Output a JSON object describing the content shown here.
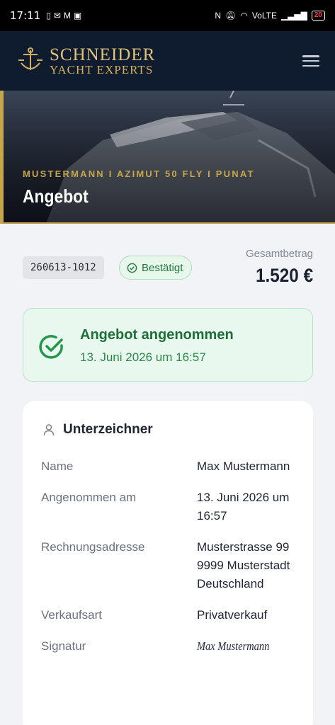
{
  "status_bar": {
    "time": "17:11",
    "network": "VoLTE",
    "battery": "20"
  },
  "header": {
    "brand_line1": "SCHNEIDER",
    "brand_line2": "YACHT EXPERTS"
  },
  "hero": {
    "subtitle": "MUSTERMANN I AZIMUT 50 FLY I PUNAT",
    "title": "Angebot"
  },
  "offer": {
    "reference": "260613-1012",
    "status": "Bestätigt",
    "total_label": "Gesamtbetrag",
    "total_value": "1.520 €"
  },
  "acceptance": {
    "title": "Angebot angenommen",
    "date": "13. Juni 2026 um 16:57"
  },
  "signer": {
    "heading": "Unterzeichner",
    "rows": [
      {
        "label": "Name",
        "value": "Max Mustermann"
      },
      {
        "label": "Angenommen am",
        "value": "13. Juni 2026 um 16:57"
      },
      {
        "label": "Rechnungsadresse",
        "value": "Musterstrasse 99 9999 Musterstadt Deutschland"
      },
      {
        "label": "Verkaufsart",
        "value": "Privatverkauf"
      },
      {
        "label": "Signatur",
        "value": "Max Mustermann"
      }
    ]
  },
  "colors": {
    "navy": "#0f1b2e",
    "gold": "#c7a64a",
    "success": "#1e7a3c"
  }
}
